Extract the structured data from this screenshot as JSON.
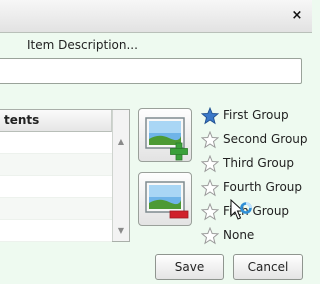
{
  "window": {
    "close_glyph": "×"
  },
  "item_description": {
    "label": "Item Description...",
    "value": ""
  },
  "contents_list": {
    "header": "tents",
    "row_count": 5
  },
  "image_buttons": [
    {
      "icon": "add-image-icon",
      "accent": "#3aa03a"
    },
    {
      "icon": "remove-image-icon",
      "accent": "#d0202a"
    }
  ],
  "groups": [
    {
      "label": "First Group",
      "selected": true
    },
    {
      "label": "Second Group",
      "selected": false
    },
    {
      "label": "Third Group",
      "selected": false
    },
    {
      "label": "Fourth Group",
      "selected": false
    },
    {
      "label": "Fifth Group",
      "selected": false
    },
    {
      "label": "None",
      "selected": false
    }
  ],
  "actions": {
    "save_label": "Save",
    "cancel_label": "Cancel"
  },
  "colors": {
    "selected_star": "#3b78c8",
    "unselected_star": "#9a9a9a",
    "background": "#eefaf0"
  }
}
